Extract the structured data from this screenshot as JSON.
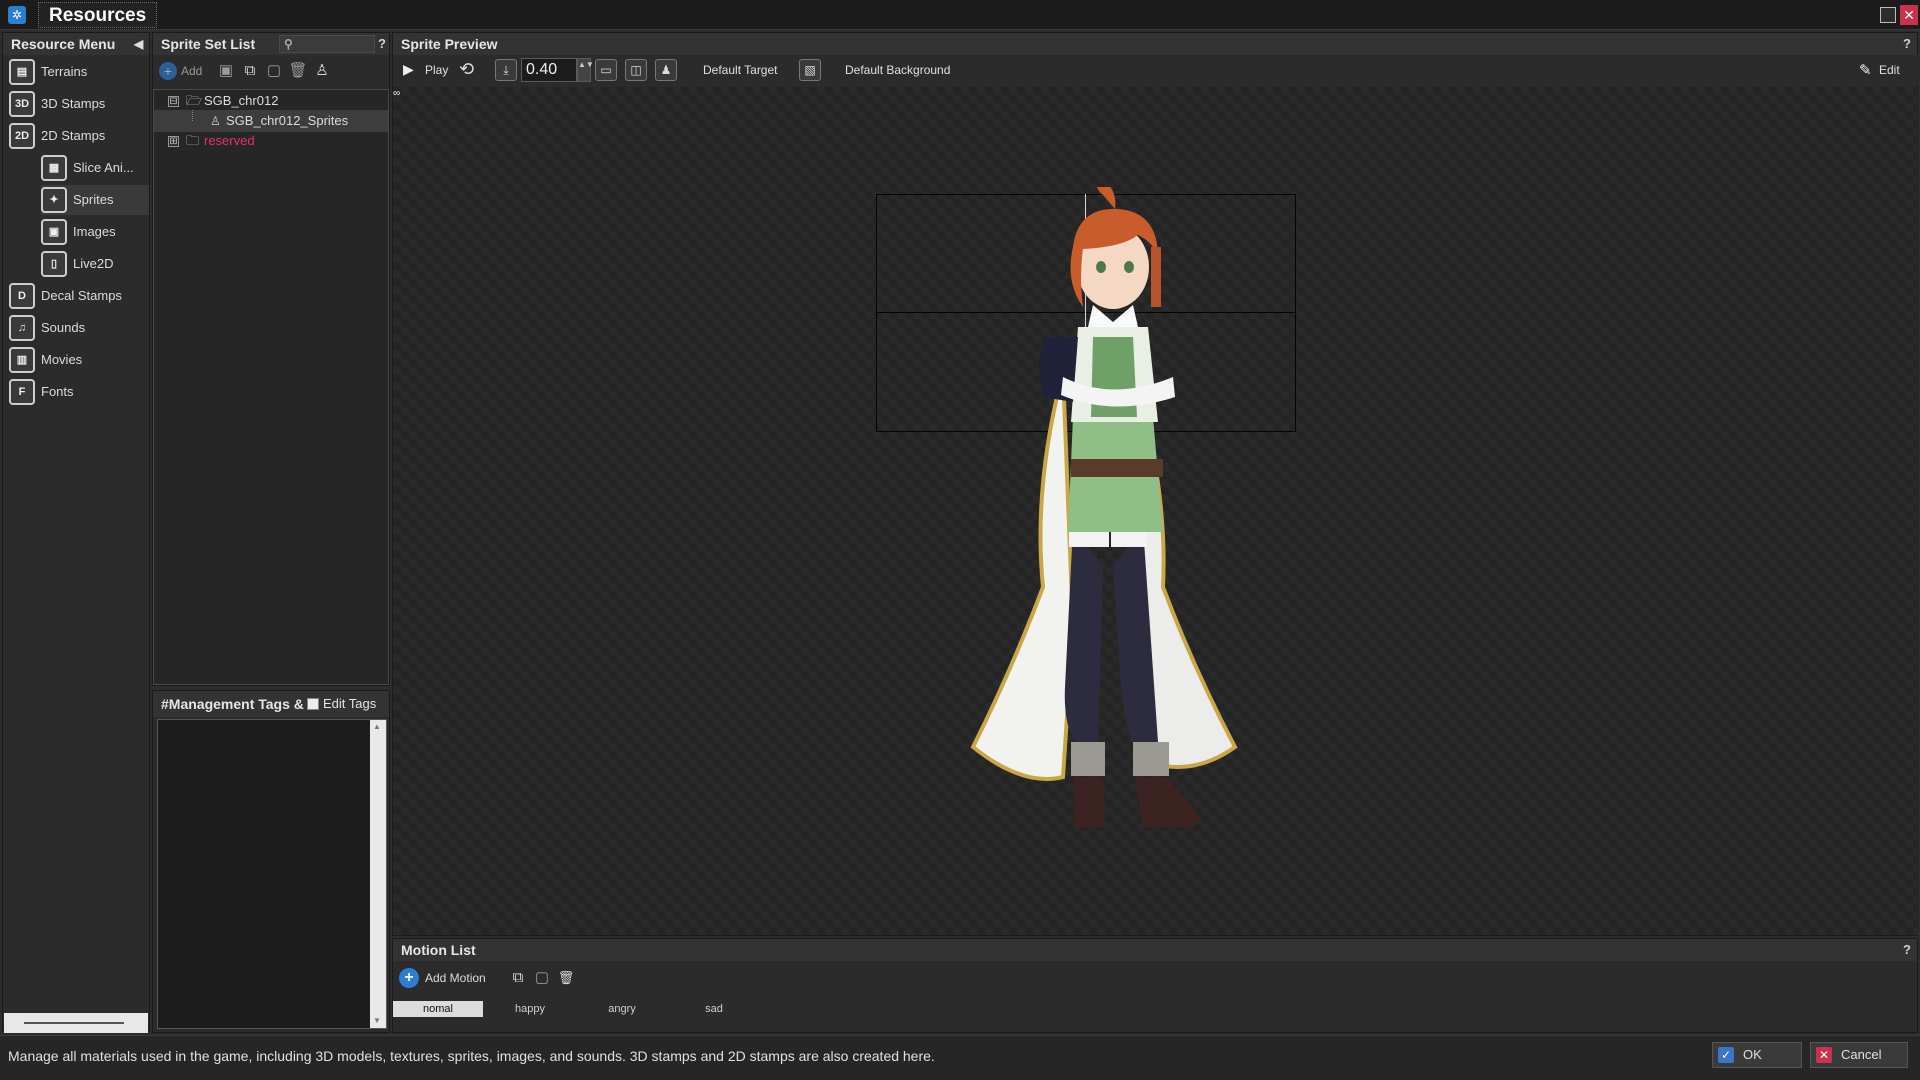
{
  "window": {
    "title": "Resources",
    "maximize_icon": "maximize-icon",
    "close_icon": "close-icon",
    "close_glyph": "✕"
  },
  "resource_menu": {
    "header": "Resource Menu",
    "collapse_glyph": "◀",
    "items": [
      {
        "label": "Terrains",
        "icon": "terrain-icon",
        "glyph": "▤"
      },
      {
        "label": "3D Stamps",
        "icon": "3d-stamp-icon",
        "glyph": "3D"
      },
      {
        "label": "2D Stamps",
        "icon": "2d-stamp-icon",
        "glyph": "2D"
      },
      {
        "label": "Slice Ani...",
        "icon": "slice-animation-icon",
        "glyph": "▦"
      },
      {
        "label": "Sprites",
        "icon": "sprite-icon",
        "glyph": "✦"
      },
      {
        "label": "Images",
        "icon": "image-icon",
        "glyph": "▣"
      },
      {
        "label": "Live2D",
        "icon": "live2d-icon",
        "glyph": "▯"
      },
      {
        "label": "Decal Stamps",
        "icon": "decal-stamp-icon",
        "glyph": "D"
      },
      {
        "label": "Sounds",
        "icon": "music-note-icon",
        "glyph": "♫"
      },
      {
        "label": "Movies",
        "icon": "film-icon",
        "glyph": "▥"
      },
      {
        "label": "Fonts",
        "icon": "font-icon",
        "glyph": "F"
      }
    ],
    "selected": "Sprites"
  },
  "sprite_set_list": {
    "header": "Sprite Set List",
    "help": "?",
    "search_glyph": "⚲",
    "toolbar": {
      "add_label": "Add"
    },
    "tree": [
      {
        "label": "SGB_chr012",
        "type": "folder",
        "expanded": true,
        "expander": "⊟"
      },
      {
        "label": "SGB_chr012_Sprites",
        "type": "sprite",
        "selected": true,
        "glyph": "♙"
      },
      {
        "label": "reserved",
        "type": "folder",
        "expanded": false,
        "color": "#e0336e",
        "expander": "⊞"
      }
    ]
  },
  "management_tags": {
    "header": "#Management Tags & I",
    "edit_tags_label": "Edit Tags",
    "scroll_up": "▲",
    "scroll_down": "▼"
  },
  "sprite_preview": {
    "header": "Sprite Preview",
    "help": "?",
    "mini_glyph": "∞",
    "toolbar": {
      "play_glyph": "▶",
      "play_label": "Play",
      "loop_glyph": "⟲",
      "fit_glyph": "⤓",
      "zoom_value": "0.40",
      "spin_glyph": "▲▼",
      "view1_glyph": "▭",
      "view2_glyph": "◫",
      "view3_glyph": "♟",
      "target_label": "Default Target",
      "background_glyph": "▧",
      "background_label": "Default Background",
      "edit_glyph": "✎",
      "edit_label": "Edit"
    }
  },
  "motion_list": {
    "header": "Motion List",
    "help": "?",
    "add_glyph": "+",
    "add_motion_label": "Add Motion",
    "copy_glyph": "⧉",
    "paste_glyph": "▢",
    "delete_glyph": "🗑",
    "motions": [
      "nomal",
      "happy",
      "angry",
      "sad"
    ],
    "selected": "nomal"
  },
  "status": {
    "text": "Manage all materials used in the game, including 3D models, textures, sprites, images, and sounds. 3D stamps and 2D stamps are also created here."
  },
  "buttons": {
    "ok_label": "OK",
    "ok_glyph": "✓",
    "cancel_label": "Cancel",
    "cancel_glyph": "✕"
  },
  "colors": {
    "accent_blue": "#2a7fd4",
    "reserved_pink": "#e0336e",
    "cancel_red": "#c9324a",
    "ok_blue": "#3c74c6"
  }
}
